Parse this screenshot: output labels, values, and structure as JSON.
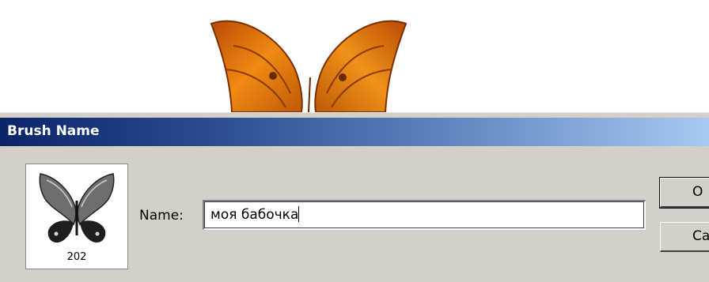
{
  "dialog": {
    "title": "Brush Name",
    "name_label": "Name:",
    "name_value": "моя бабочка",
    "brush_size": "202",
    "ok_label": "O",
    "cancel_label": "Ca"
  },
  "colors": {
    "title_gradient_start": "#0a246a",
    "title_gradient_end": "#a6caf0",
    "dialog_bg": "#d4d0c8",
    "butterfly_orange": "#e07a10"
  },
  "icons": {
    "canvas": "orange-butterfly-wings",
    "preview": "grayscale-butterfly-brush"
  }
}
